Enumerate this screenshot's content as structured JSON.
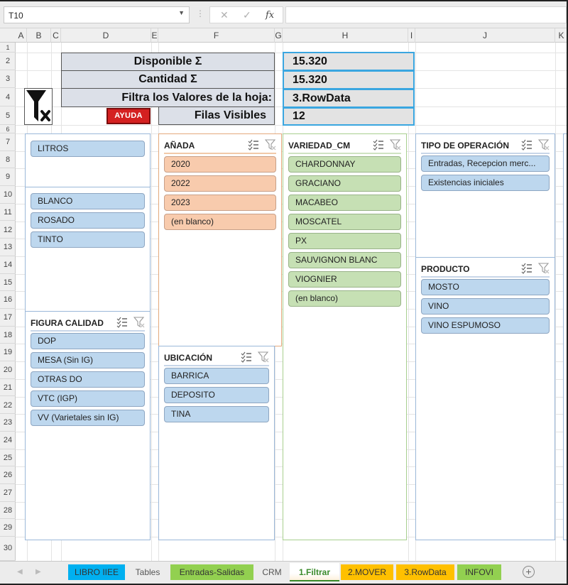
{
  "formula_bar": {
    "name_box": "T10",
    "cancel_icon": "✕",
    "enter_icon": "✓",
    "fx_label": "fx",
    "formula": ""
  },
  "columns": [
    "A",
    "B",
    "C",
    "D",
    "E",
    "F",
    "G",
    "H",
    "I",
    "J",
    "K"
  ],
  "rows": [
    "1",
    "2",
    "3",
    "4",
    "5",
    "6",
    "7",
    "8",
    "9",
    "10",
    "11",
    "12",
    "13",
    "14",
    "15",
    "16",
    "17",
    "18",
    "19",
    "20",
    "21",
    "22",
    "23",
    "24",
    "25",
    "26",
    "27",
    "28",
    "29",
    "30"
  ],
  "summary": {
    "disponible_label": "Disponible Σ",
    "disponible_value": "15.320",
    "cantidad_label": "Cantidad Σ",
    "cantidad_value": "15.320",
    "filtra_label": "Filtra los Valores de la hoja:",
    "filtra_value": "3.RowData",
    "filas_label": "Filas Visibles",
    "filas_value": "12",
    "ayuda_button": "AYUDA"
  },
  "slicers": {
    "litros": {
      "title": "",
      "items": [
        "LITROS"
      ]
    },
    "color": {
      "title": "",
      "items": [
        "BLANCO",
        "ROSADO",
        "TINTO"
      ]
    },
    "figura_calidad": {
      "title": "FIGURA CALIDAD",
      "items": [
        "DOP",
        "MESA (Sin IG)",
        "OTRAS DO",
        "VTC (IGP)",
        "VV (Varietales sin IG)"
      ]
    },
    "anada": {
      "title": "AÑADA",
      "items": [
        "2020",
        "2022",
        "2023",
        "(en blanco)"
      ]
    },
    "ubicacion": {
      "title": "UBICACIÓN",
      "items": [
        "BARRICA",
        "DEPOSITO",
        "TINA"
      ]
    },
    "variedad": {
      "title": "VARIEDAD_CM",
      "items": [
        "CHARDONNAY",
        "GRACIANO",
        "MACABEO",
        "MOSCATEL",
        "PX",
        "SAUVIGNON BLANC",
        "VIOGNIER",
        "(en blanco)"
      ]
    },
    "tipo_operacion": {
      "title": "TIPO DE OPERACIÓN",
      "items": [
        "Entradas, Recepcion merc...",
        "Existencias iniciales"
      ]
    },
    "producto": {
      "title": "PRODUCTO",
      "items": [
        "MOSTO",
        "VINO",
        "VINO ESPUMOSO"
      ]
    }
  },
  "sheet_tabs": [
    {
      "label": "LIBRO IIEE",
      "color": "#00b0f0",
      "active": false
    },
    {
      "label": "Tables",
      "color": "",
      "active": false
    },
    {
      "label": "Entradas-Salidas",
      "color": "#92d050",
      "active": false
    },
    {
      "label": "CRM",
      "color": "",
      "active": false
    },
    {
      "label": "1.Filtrar",
      "color": "#ffc000",
      "active": true
    },
    {
      "label": "2.MOVER",
      "color": "#ffc000",
      "active": false
    },
    {
      "label": "3.RowData",
      "color": "#ffc000",
      "active": false
    },
    {
      "label": "INFOVI",
      "color": "#92d050",
      "active": false
    }
  ],
  "colors": {
    "accent_blue": "#3aa6e0",
    "slicer_blue": "#bdd7ee",
    "slicer_orange": "#f8cbad",
    "slicer_green": "#c6e0b4",
    "ayuda_red": "#d42020"
  }
}
